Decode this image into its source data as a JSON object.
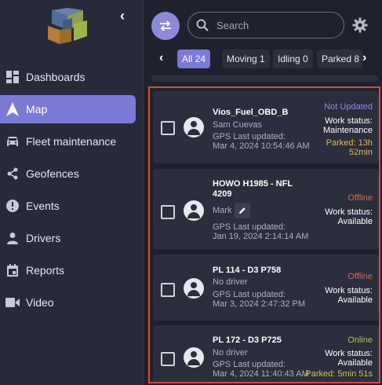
{
  "sidebar": {
    "items": [
      {
        "label": "Dashboards",
        "icon": "dashboard-icon"
      },
      {
        "label": "Map",
        "icon": "navigation-arrow-icon"
      },
      {
        "label": "Fleet maintenance",
        "icon": "car-icon"
      },
      {
        "label": "Geofences",
        "icon": "share-icon"
      },
      {
        "label": "Events",
        "icon": "alert-icon"
      },
      {
        "label": "Drivers",
        "icon": "person-icon"
      },
      {
        "label": "Reports",
        "icon": "calendar-icon"
      },
      {
        "label": "Video",
        "icon": "video-icon"
      }
    ],
    "active": "Map"
  },
  "search": {
    "placeholder": "Search"
  },
  "tabs": [
    {
      "label": "All 24"
    },
    {
      "label": "Moving 1"
    },
    {
      "label": "Idling 0"
    },
    {
      "label": "Parked 8"
    }
  ],
  "vehicles": [
    {
      "name": "Vios_Fuel_OBD_B",
      "driver": "Sam Cuevas",
      "gps_label": "GPS Last updated:",
      "gps_time": "Mar 4, 2024 10:54:46 AM",
      "status": "Not Updated",
      "work_status_label": "Work status:",
      "work_status": "Maintenance",
      "parked": "Parked: 13h",
      "parked_2": "52min"
    },
    {
      "name": "HOWO H1985 - NFL",
      "name_2": "4209",
      "driver": "Mark",
      "gps_label": "GPS Last updated:",
      "gps_time": "Jan 19, 2024 2:14:14 AM",
      "status": "Offline",
      "work_status_label": "Work status:",
      "work_status": "Available"
    },
    {
      "name": "PL 114 - D3 P758",
      "driver": "No driver",
      "gps_label": "GPS Last updated:",
      "gps_time": "Mar 3, 2024 2:47:32 PM",
      "status": "Offline",
      "work_status_label": "Work status:",
      "work_status": "Available"
    },
    {
      "name": "PL 172 - D3 P725",
      "driver": "No driver",
      "gps_label": "GPS Last updated:",
      "gps_time": "Mar 4, 2024 11:40:43 AM",
      "status": "Online",
      "work_status_label": "Work status:",
      "work_status": "Available",
      "parked": "Parked: 5min 51s"
    }
  ],
  "colors": {
    "accent": "#7b7ad6",
    "not_updated": "#8a8de8",
    "offline": "#c96d55",
    "online": "#9fc35a",
    "parked": "#e4b95a",
    "highlight_border": "#e8442f"
  }
}
